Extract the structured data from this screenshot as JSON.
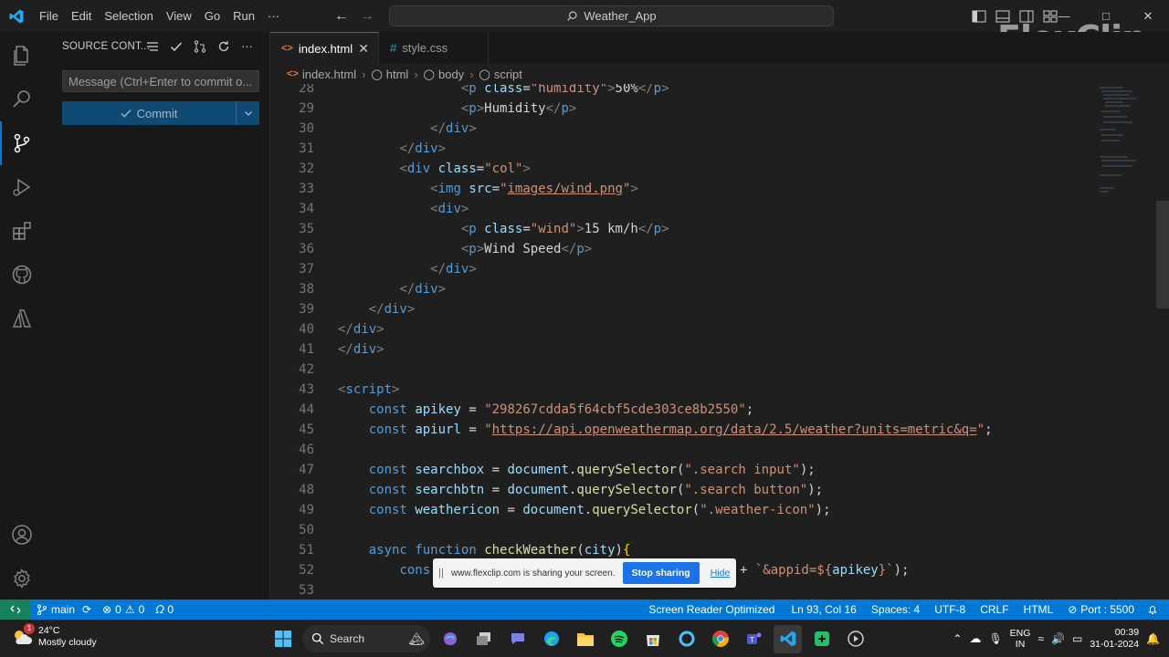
{
  "menu": [
    "File",
    "Edit",
    "Selection",
    "View",
    "Go",
    "Run",
    "···"
  ],
  "command_center": "Weather_App",
  "watermark": "FlexClip",
  "sidebar": {
    "title": "SOURCE CONT...",
    "commit_placeholder": "Message (Ctrl+Enter to commit o...",
    "commit_label": "Commit"
  },
  "tabs": [
    {
      "label": "index.html",
      "icon": "<>",
      "active": true
    },
    {
      "label": "style.css",
      "icon": "#",
      "active": false
    }
  ],
  "breadcrumb": [
    "index.html",
    "html",
    "body",
    "script"
  ],
  "code_lines": [
    {
      "n": "28"
    },
    {
      "n": "29"
    },
    {
      "n": "30"
    },
    {
      "n": "31"
    },
    {
      "n": "32"
    },
    {
      "n": "33"
    },
    {
      "n": "34"
    },
    {
      "n": "35"
    },
    {
      "n": "36"
    },
    {
      "n": "37"
    },
    {
      "n": "38"
    },
    {
      "n": "39"
    },
    {
      "n": "40"
    },
    {
      "n": "41"
    },
    {
      "n": "42"
    },
    {
      "n": "43"
    },
    {
      "n": "44"
    },
    {
      "n": "45"
    },
    {
      "n": "46"
    },
    {
      "n": "47"
    },
    {
      "n": "48"
    },
    {
      "n": "49"
    },
    {
      "n": "50"
    },
    {
      "n": "51"
    },
    {
      "n": "52"
    },
    {
      "n": "53"
    }
  ],
  "code": {
    "l28_class": "humidity",
    "l28_text": "50%",
    "l29_text": "Humidity",
    "l32_class": "col",
    "l33_src": "images/wind.png",
    "l35_class": "wind",
    "l35_text": "15 km/h",
    "l36_text": "Wind Speed",
    "l44_var": "apikey",
    "l44_val": "\"298267cdda5f64cbf5cde303ce8b2550\"",
    "l45_var": "apiurl",
    "l45_val": "https://api.openweathermap.org/data/2.5/weather?units=metric&q=",
    "l47_var": "searchbox",
    "l47_arg": "\".search input\"",
    "l48_var": "searchbtn",
    "l48_arg": "\".search button\"",
    "l49_var": "weathericon",
    "l49_arg": "\".weather-icon\"",
    "l51_fn": "checkWeather",
    "l51_param": "city",
    "l52_start": "cons",
    "l52_tail_str": "`&appid=${",
    "l52_tail_var": "apikey",
    "l52_tail_end": "}`"
  },
  "share_banner": {
    "grip": "||",
    "text": "www.flexclip.com is sharing your screen.",
    "stop_label": "Stop sharing",
    "hide_label": "Hide"
  },
  "status": {
    "branch": "main",
    "errors": "0",
    "warnings": "0",
    "ports": "0",
    "screen_reader": "Screen Reader Optimized",
    "position": "Ln 93, Col 16",
    "spaces": "Spaces: 4",
    "encoding": "UTF-8",
    "eol": "CRLF",
    "language": "HTML",
    "port": "Port : 5500"
  },
  "taskbar": {
    "weather_temp": "24°C",
    "weather_desc": "Mostly cloudy",
    "weather_badge": "1",
    "search_label": "Search",
    "lang_top": "ENG",
    "lang_bottom": "IN",
    "time": "00:39",
    "date": "31-01-2024"
  },
  "colors": {
    "accent": "#0078d4",
    "statusbar": "#0078d4",
    "remote": "#16825d",
    "editor_bg": "#1f1f1f"
  }
}
